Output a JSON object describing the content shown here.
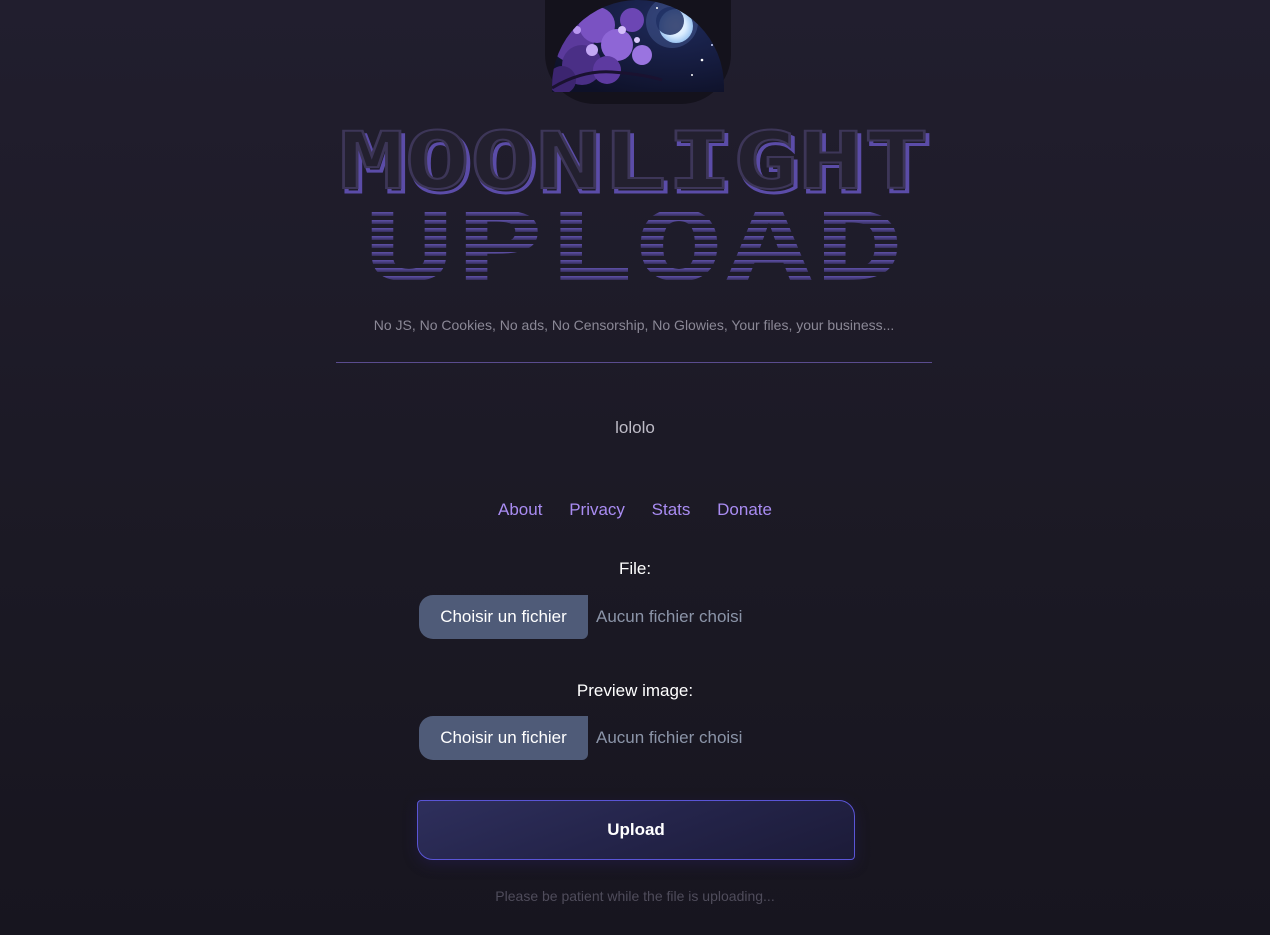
{
  "header": {
    "logo_line1": "MOONLIGHT",
    "logo_line2": "UPLOAD",
    "tagline": "No JS, No Cookies, No ads, No Censorship, No Glowies, Your files, your business..."
  },
  "main": {
    "message": "lololo"
  },
  "nav": {
    "items": [
      {
        "label": "About"
      },
      {
        "label": "Privacy"
      },
      {
        "label": "Stats"
      },
      {
        "label": "Donate"
      }
    ]
  },
  "form": {
    "file": {
      "label": "File:",
      "button_label": "Choisir un fichier",
      "status": "Aucun fichier choisi"
    },
    "preview": {
      "label": "Preview image:",
      "button_label": "Choisir un fichier",
      "status": "Aucun fichier choisi"
    },
    "submit_label": "Upload",
    "hint": "Please be patient while the file is uploading..."
  },
  "colors": {
    "accent": "#a98cf2",
    "logo_stroke": "#6b5bbf",
    "button": "#4f5b78",
    "upload_border": "#5a55d6"
  },
  "icons": {
    "badge": "moon-night-sky-image"
  }
}
